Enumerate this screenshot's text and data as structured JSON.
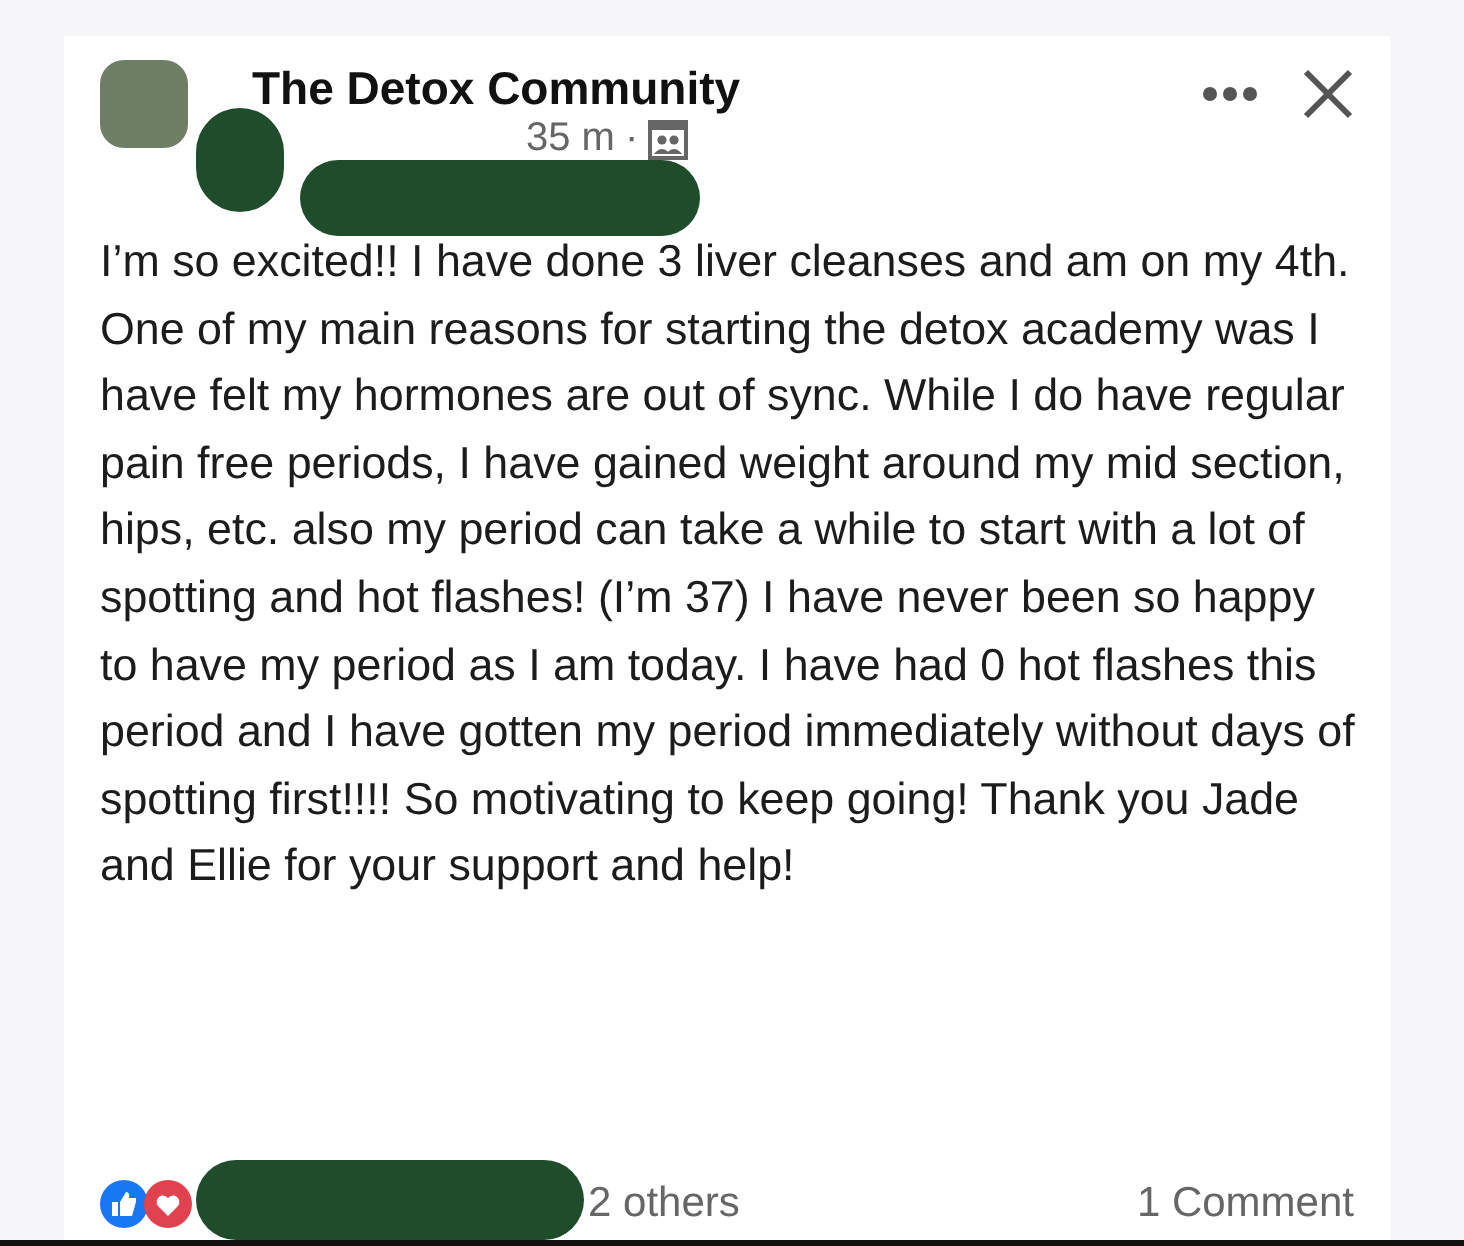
{
  "post": {
    "group_name": "The Detox Community",
    "time": "35 m",
    "separator": "·",
    "body": "I’m so excited!! I have done 3 liver cleanses and am on my 4th. One of my main reasons for starting the detox academy was I have felt my hormones are out of sync. While I do have regular pain free periods, I have gained weight around my mid section, hips, etc. also my period can take a while to start with a lot of spotting and hot flashes! (I’m 37) I have never been so happy to have my period as I am today. I have had 0 hot flashes this period and I have gotten my period immediately without days of spotting first!!!! So motivating to keep going! Thank you Jade and Ellie for your support and help!",
    "reactions_text": "2 others",
    "comments": "1 Comment"
  }
}
